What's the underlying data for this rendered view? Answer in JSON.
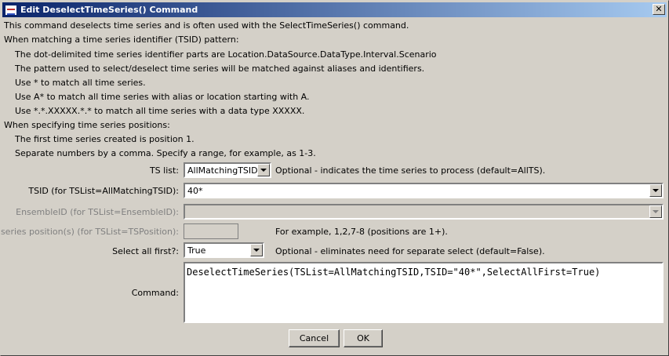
{
  "window": {
    "title": "Edit DeselectTimeSeries() Command",
    "close_glyph": "✕"
  },
  "description": {
    "lines": [
      "This command deselects time series and is often used with the SelectTimeSeries() command.",
      "When matching a time series identifier (TSID) pattern:",
      "The dot-delimited time series identifier parts are Location.DataSource.DataType.Interval.Scenario",
      "The pattern used to select/deselect time series will be matched against aliases and identifiers.",
      "Use * to match all time series.",
      "Use A* to match all time series with alias or location starting with A.",
      "Use *.*.XXXXX.*.* to match all time series with a data type XXXXX.",
      "When specifying time series positions:",
      "The first time series created is position 1.",
      "Separate numbers by a comma.  Specify a range, for example, as 1-3."
    ]
  },
  "form": {
    "tslist": {
      "label": "TS list:",
      "value": "AllMatchingTSID",
      "note": "Optional - indicates the time series to process (default=AllTS)."
    },
    "tsid": {
      "label": "TSID (for TSList=AllMatchingTSID):",
      "value": "40*"
    },
    "ensemble": {
      "label": "EnsembleID (for TSList=EnsembleID):",
      "value": ""
    },
    "position": {
      "label": "Time series position(s) (for TSList=TSPosition):",
      "value": "",
      "note": "For example, 1,2,7-8 (positions are 1+)."
    },
    "select_all_first": {
      "label": "Select all first?:",
      "value": "True",
      "note": "Optional - eliminates need for separate select (default=False)."
    },
    "command": {
      "label": "Command:",
      "value": "DeselectTimeSeries(TSList=AllMatchingTSID,TSID=\"40*\",SelectAllFirst=True)"
    }
  },
  "buttons": {
    "cancel": "Cancel",
    "ok": "OK"
  }
}
